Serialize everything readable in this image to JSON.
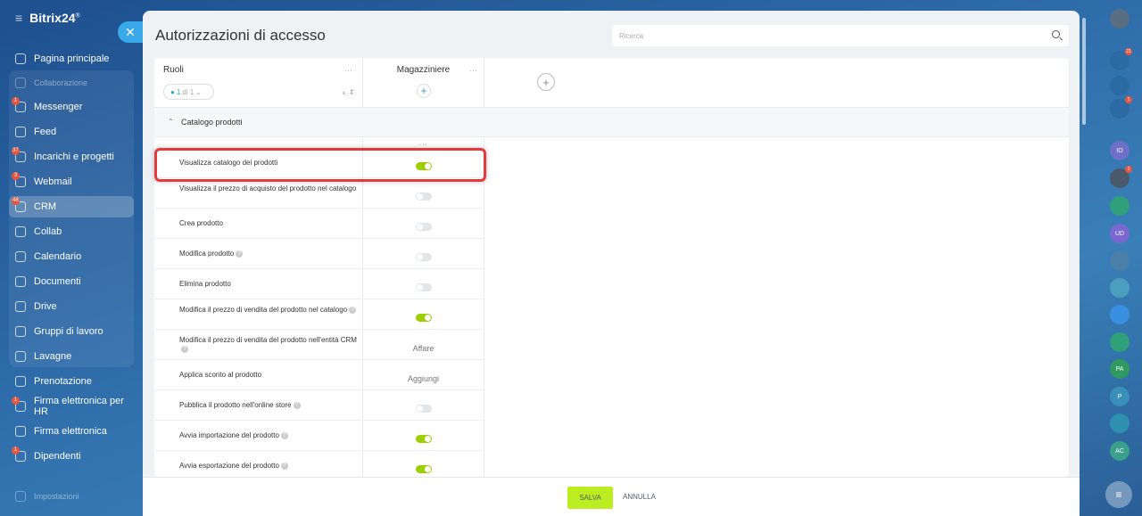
{
  "app": {
    "logo": "Bitrix24",
    "logo_suffix": "®"
  },
  "sidebar": {
    "items": [
      {
        "label": "Pagina principale",
        "icon": "home-icon",
        "badge": ""
      },
      {
        "label": "Collaborazione",
        "icon": "collab-group-icon",
        "badge": ""
      },
      {
        "label": "Messenger",
        "icon": "chat-icon",
        "badge": "1"
      },
      {
        "label": "Feed",
        "icon": "feed-icon",
        "badge": ""
      },
      {
        "label": "Incarichi e progetti",
        "icon": "tasks-icon",
        "badge": "37"
      },
      {
        "label": "Webmail",
        "icon": "mail-icon",
        "badge": "3"
      },
      {
        "label": "CRM",
        "icon": "crm-icon",
        "badge": "48"
      },
      {
        "label": "Collab",
        "icon": "collab-icon",
        "badge": ""
      },
      {
        "label": "Calendario",
        "icon": "calendar-icon",
        "badge": ""
      },
      {
        "label": "Documenti",
        "icon": "document-icon",
        "badge": ""
      },
      {
        "label": "Drive",
        "icon": "drive-icon",
        "badge": ""
      },
      {
        "label": "Gruppi di lavoro",
        "icon": "groups-icon",
        "badge": ""
      },
      {
        "label": "Lavagne",
        "icon": "board-icon",
        "badge": ""
      },
      {
        "label": "Prenotazione",
        "icon": "booking-icon",
        "badge": ""
      },
      {
        "label": "Firma elettronica per HR",
        "icon": "sign-hr-icon",
        "badge": "1"
      },
      {
        "label": "Firma elettronica",
        "icon": "sign-icon",
        "badge": ""
      },
      {
        "label": "Dipendenti",
        "icon": "employees-icon",
        "badge": "1"
      },
      {
        "label": "Impostazioni",
        "icon": "settings-icon",
        "badge": ""
      }
    ]
  },
  "panel": {
    "title": "Autorizzazioni di accesso",
    "search_placeholder": "Ricerca",
    "roles_header": "Ruoli",
    "pager": {
      "current": "1",
      "of": "di 1"
    },
    "role_column": "Magazziniere",
    "section": "Catalogo prodotti",
    "more": "...",
    "rows": [
      {
        "label": "Visualizza catalogo dei prodotti",
        "help": false,
        "value_type": "toggle",
        "on": true,
        "value": ""
      },
      {
        "label": "Visualizza il prezzo di acquisto del prodotto nel catalogo",
        "help": false,
        "value_type": "toggle",
        "on": false,
        "value": ""
      },
      {
        "label": "Crea prodotto",
        "help": false,
        "value_type": "toggle",
        "on": false,
        "value": ""
      },
      {
        "label": "Modifica prodotto",
        "help": true,
        "value_type": "toggle",
        "on": false,
        "value": ""
      },
      {
        "label": "Elimina prodotto",
        "help": false,
        "value_type": "toggle",
        "on": false,
        "value": ""
      },
      {
        "label": "Modifica il prezzo di vendita del prodotto nel catalogo",
        "help": true,
        "value_type": "toggle",
        "on": true,
        "value": ""
      },
      {
        "label": "Modifica il prezzo di vendita del prodotto nell'entità CRM",
        "help": true,
        "value_type": "text",
        "on": false,
        "value": "Affare"
      },
      {
        "label": "Applica sconto al prodotto",
        "help": false,
        "value_type": "text",
        "on": false,
        "value": "Aggiungi"
      },
      {
        "label": "Pubblica il prodotto nell'online store",
        "help": true,
        "value_type": "toggle",
        "on": false,
        "value": ""
      },
      {
        "label": "Avvia importazione del prodotto",
        "help": true,
        "value_type": "toggle",
        "on": true,
        "value": ""
      },
      {
        "label": "Avvia esportazione del prodotto",
        "help": true,
        "value_type": "toggle",
        "on": true,
        "value": ""
      }
    ],
    "footer": {
      "save": "SALVA",
      "cancel": "ANNULLA"
    }
  },
  "right_sidebar": {
    "avatars": [
      {
        "label": "",
        "badge": "",
        "color": "#5a6e82"
      },
      {
        "label": "",
        "badge": "21",
        "color": "#2c6aa3"
      },
      {
        "label": "",
        "badge": "",
        "color": "#2c6aa3"
      },
      {
        "label": "",
        "badge": "1",
        "color": "#2c6aa3"
      },
      {
        "label": "IO",
        "badge": "",
        "color": "#6d6fc9"
      },
      {
        "label": "",
        "badge": "1",
        "color": "#4a5a6a"
      },
      {
        "label": "",
        "badge": "",
        "color": "#2fa079"
      },
      {
        "label": "UD",
        "badge": "",
        "color": "#7a68d0"
      },
      {
        "label": "",
        "badge": "",
        "color": "#4a7fa8"
      },
      {
        "label": "",
        "badge": "",
        "color": "#4a9fbf"
      },
      {
        "label": "",
        "badge": "",
        "color": "#3a8fe0"
      },
      {
        "label": "",
        "badge": "",
        "color": "#2fa079"
      },
      {
        "label": "PA",
        "badge": "",
        "color": "#2f9a5f"
      },
      {
        "label": "P",
        "badge": "",
        "color": "#3a8fb8"
      },
      {
        "label": "",
        "badge": "",
        "color": "#2f8fb0"
      },
      {
        "label": "AC",
        "badge": "",
        "color": "#3aa08a"
      }
    ]
  }
}
